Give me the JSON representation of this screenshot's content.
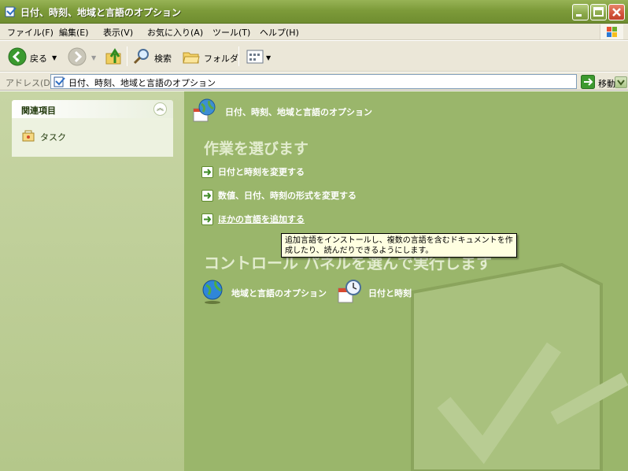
{
  "window": {
    "title": "日付、時刻、地域と言語のオプション"
  },
  "menu": [
    "ファイル(F)",
    "編集(E)",
    "表示(V)",
    "お気に入り(A)",
    "ツール(T)",
    "ヘルプ(H)"
  ],
  "toolbar": {
    "back_label": "戻る",
    "search_label": "検索",
    "folders_label": "フォルダ"
  },
  "address": {
    "label": "アドレス(D)",
    "value": "日付、時刻、地域と言語のオプション",
    "go_label": "移動"
  },
  "sidebar": {
    "panel_title": "関連項目",
    "items": [
      {
        "label": "タスク",
        "icon": "task-icon"
      }
    ]
  },
  "main": {
    "page_title": "日付、時刻、地域と言語のオプション",
    "task_heading": "作業を選びます",
    "tasks": [
      {
        "label": "日付と時刻を変更する"
      },
      {
        "label": "数値、日付、時刻の形式を変更する"
      },
      {
        "label": "ほかの言語を追加する"
      }
    ],
    "cp_heading": "コントロール パネルを選んで実行します",
    "cp_items": [
      {
        "label": "地域と言語のオプション",
        "icon": "globe-icon"
      },
      {
        "label": "日付と時刻",
        "icon": "clock-calendar-icon"
      }
    ]
  },
  "tooltip": {
    "line1": "追加言語をインストールし、複数の言語を含むドキュメントを作",
    "line2": "成したり、読んだりできるようにします。"
  },
  "colors": {
    "content_bg": "#9ab66b",
    "sidebar_bg": "#c7d5a4",
    "titlebar": "#7d9b3a"
  }
}
